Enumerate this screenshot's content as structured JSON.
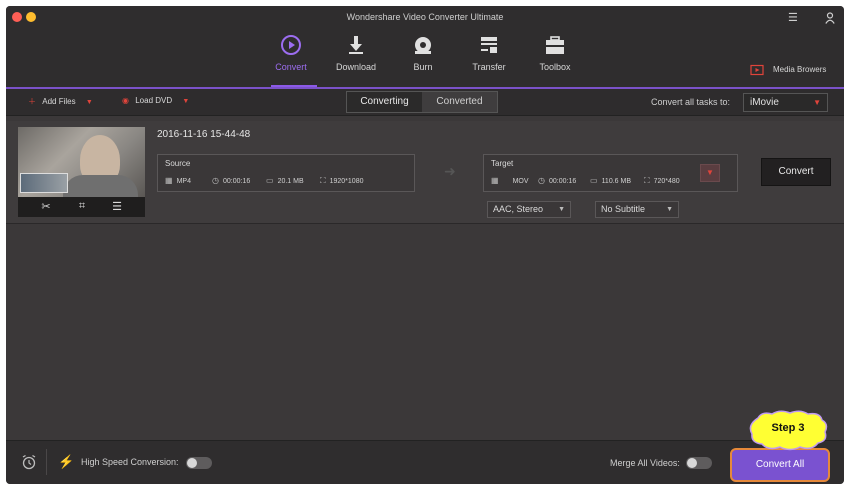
{
  "window": {
    "title": "Wondershare Video Converter Ultimate"
  },
  "tabs": [
    {
      "label": "Convert",
      "icon": "convert-icon",
      "active": true
    },
    {
      "label": "Download",
      "icon": "download-icon"
    },
    {
      "label": "Burn",
      "icon": "burn-icon"
    },
    {
      "label": "Transfer",
      "icon": "transfer-icon"
    },
    {
      "label": "Toolbox",
      "icon": "toolbox-icon"
    }
  ],
  "media_browser": {
    "label": "Media Browers"
  },
  "toolbar": {
    "add_files": "Add Files",
    "load_dvd": "Load DVD",
    "segments": [
      "Converting",
      "Converted"
    ],
    "convert_all_tasks_label": "Convert all tasks to:",
    "convert_all_tasks_value": "iMovie"
  },
  "file": {
    "name": "2016-11-16 15-44-48",
    "source": {
      "title": "Source",
      "format": "MP4",
      "duration": "00:00:16",
      "size": "20.1 MB",
      "resolution": "1920*1080"
    },
    "target": {
      "title": "Target",
      "format": "MOV",
      "duration": "00:00:16",
      "size": "110.6 MB",
      "resolution": "720*480"
    },
    "audio": "AAC, Stereo",
    "subtitle": "No Subtitle",
    "convert_button": "Convert"
  },
  "bottom": {
    "high_speed_label": "High Speed Conversion:",
    "merge_label": "Merge All Videos:",
    "convert_all": "Convert All",
    "callout": "Step 3"
  },
  "colors": {
    "accent_purple": "#8c5ae8",
    "accent_red": "#e0443b",
    "highlight_orange": "#e6893a",
    "callout_yellow": "#ffff33"
  }
}
